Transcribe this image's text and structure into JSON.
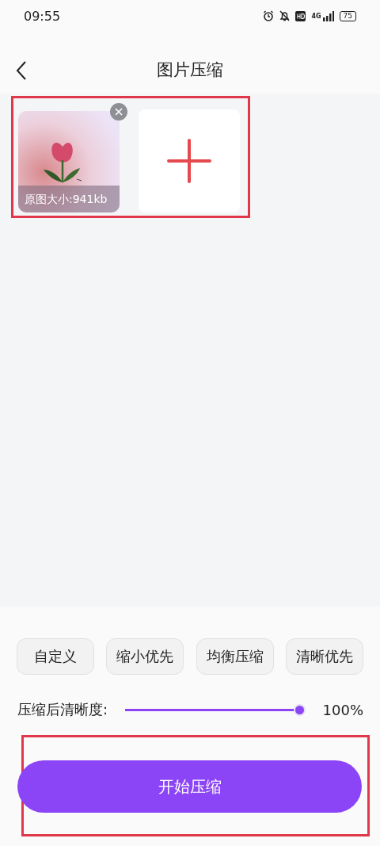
{
  "status_bar": {
    "time": "09:55",
    "battery": "75",
    "network": "4G"
  },
  "header": {
    "title": "图片压缩"
  },
  "images": [
    {
      "kind": "picture",
      "caption": "原图大小:941kb"
    },
    {
      "kind": "add"
    }
  ],
  "presets": [
    {
      "label": "自定义",
      "selected": false
    },
    {
      "label": "缩小优先",
      "selected": false
    },
    {
      "label": "均衡压缩",
      "selected": false
    },
    {
      "label": "清晰优先",
      "selected": false
    }
  ],
  "quality": {
    "label": "压缩后清晰度:",
    "level": 1,
    "reading": "100%"
  },
  "start_button": {
    "label": "开始压缩"
  }
}
